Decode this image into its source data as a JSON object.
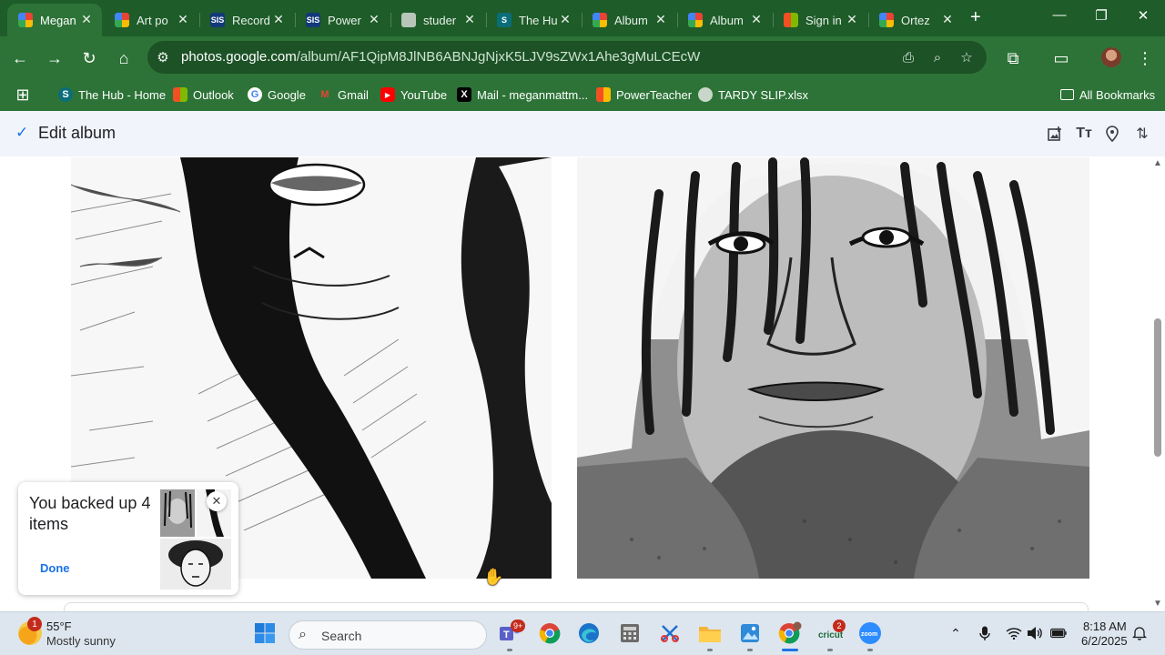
{
  "browser": {
    "tabs": [
      {
        "title": "Megan",
        "icon": "google-photos-icon",
        "active": true
      },
      {
        "title": "Art po",
        "icon": "google-photos-icon"
      },
      {
        "title": "Record",
        "icon": "sis-icon"
      },
      {
        "title": "Power",
        "icon": "sis-icon"
      },
      {
        "title": "studer",
        "icon": "globe-icon"
      },
      {
        "title": "The Hu",
        "icon": "sharepoint-icon"
      },
      {
        "title": "Album",
        "icon": "google-photos-icon"
      },
      {
        "title": "Album",
        "icon": "google-photos-icon"
      },
      {
        "title": "Sign in",
        "icon": "microsoft-icon"
      },
      {
        "title": "Ortez",
        "icon": "google-photos-icon"
      }
    ],
    "favicon_text": {
      "sis": "SIS",
      "sharepoint": "S"
    },
    "url_host": "photos.google.com",
    "url_path": "/album/AF1QipM8JlNB6ABNJgNjxK5LJV9sZWx1Ahe3gMuLCEcW",
    "bookmarks": [
      {
        "label": "The Hub - Home",
        "icon": "sharepoint-icon"
      },
      {
        "label": "Outlook",
        "icon": "microsoft-icon"
      },
      {
        "label": "Google",
        "icon": "google-icon"
      },
      {
        "label": "Gmail",
        "icon": "gmail-icon"
      },
      {
        "label": "YouTube",
        "icon": "youtube-icon"
      },
      {
        "label": "Mail - meganmattm...",
        "icon": "x-icon"
      },
      {
        "label": "PowerTeacher",
        "icon": "microsoft-icon"
      },
      {
        "label": "TARDY SLIP.xlsx",
        "icon": "globe-icon"
      }
    ],
    "bookmark_icon_text": {
      "google": "G",
      "gmail": "M",
      "youtube": "▶",
      "x": "X"
    },
    "all_bookmarks": "All Bookmarks",
    "theme_colors": {
      "tabstrip": "#1e5c2a",
      "toolbar": "#2d7337"
    }
  },
  "page": {
    "edit_album_label": "Edit album",
    "toolbar_icons": [
      "add-photos-icon",
      "text-icon",
      "location-icon",
      "sort-icon"
    ],
    "toast": {
      "message": "You backed up 4 items",
      "done_label": "Done"
    }
  },
  "taskbar": {
    "weather": {
      "badge": "1",
      "temp": "55°F",
      "desc": "Mostly sunny"
    },
    "search_label": "Search",
    "apps": [
      {
        "name": "teams",
        "badge": "9+"
      },
      {
        "name": "chrome"
      },
      {
        "name": "edge"
      },
      {
        "name": "calculator"
      },
      {
        "name": "snipping-tool"
      },
      {
        "name": "file-explorer"
      },
      {
        "name": "photos"
      },
      {
        "name": "chrome-profile"
      },
      {
        "name": "cricut",
        "badge": "2",
        "label": "cricut"
      },
      {
        "name": "zoom",
        "label": "zoom"
      }
    ],
    "clock": {
      "time": "8:18 AM",
      "date": "6/2/2025"
    }
  }
}
